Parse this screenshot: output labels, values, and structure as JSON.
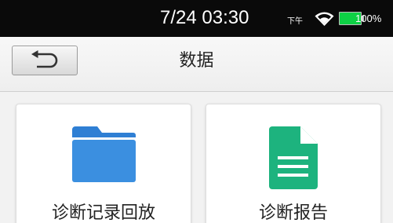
{
  "status_bar": {
    "time": "7/24 03:30",
    "ampm": "下午",
    "battery_percent": "100%",
    "battery_level": 1.0,
    "icons": [
      "wifi-icon",
      "battery-icon"
    ]
  },
  "header": {
    "title": "数据",
    "back_icon": "back-arrow-icon"
  },
  "tiles": [
    {
      "label": "诊断记录回放",
      "icon": "folder-icon",
      "color": "#3b8fe0"
    },
    {
      "label": "诊断报告",
      "icon": "document-icon",
      "color": "#1db37e"
    }
  ]
}
